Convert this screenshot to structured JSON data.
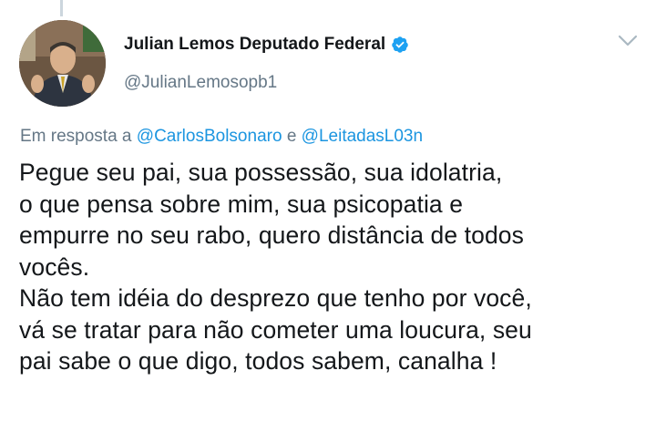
{
  "author": {
    "display_name": "Julian Lemos Deputado Federal",
    "handle": "@JulianLemosopb1",
    "verified": true,
    "avatar_icon": "user-photo"
  },
  "reply_context": {
    "prefix": "Em resposta a",
    "mention_1": "@CarlosBolsonaro",
    "conjunction": "e",
    "mention_2": "@LeitadasL03n"
  },
  "tweet": {
    "text": "Pegue seu pai, sua possessão, sua idolatria,\no que pensa sobre mim, sua psicopatia e\nempurre no seu rabo, quero distância de todos\nvocês.\nNão tem idéia do desprezo que tenho por você,\nvá se tratar para não cometer uma loucura, seu\npai sabe o que digo, todos sabem, canalha !"
  },
  "colors": {
    "text": "#14171a",
    "secondary": "#657786",
    "link": "#1b95e0",
    "verified": "#1da1f2"
  },
  "icons": {
    "verified": "verified-badge-icon",
    "menu": "chevron-down-icon"
  }
}
